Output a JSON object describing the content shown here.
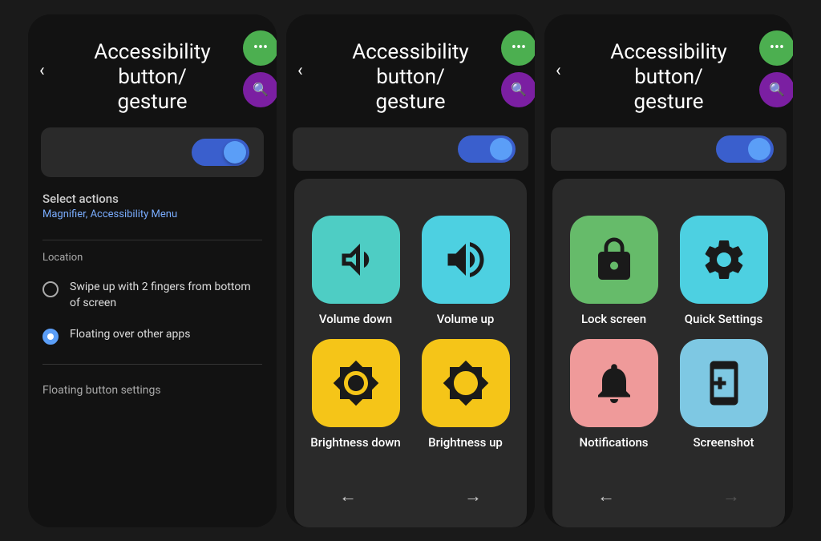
{
  "screens": [
    {
      "id": "screen1",
      "title": "Accessibility button/\ngesture",
      "back": "‹",
      "fab": {
        "green": "···",
        "purple": "🔍"
      },
      "toggle_on": true,
      "select_actions": {
        "label": "Select actions",
        "sub": "Magnifier, Accessibility Menu"
      },
      "location": {
        "label": "Location",
        "options": [
          {
            "id": "opt1",
            "text": "Swipe up with 2 fingers from bottom of screen",
            "selected": false
          },
          {
            "id": "opt2",
            "text": "Floating over other apps",
            "selected": true
          }
        ]
      },
      "floating_btn_settings": "Floating button settings"
    },
    {
      "id": "screen2",
      "title": "Accessibility button/\ngesture",
      "back": "‹",
      "fab": {
        "green": "···",
        "purple": "🔍"
      },
      "actions": [
        {
          "id": "volume-down",
          "label": "Volume down",
          "icon": "volume_down",
          "bg": "teal"
        },
        {
          "id": "volume-up",
          "label": "Volume up",
          "icon": "volume_up",
          "bg": "teal2"
        },
        {
          "id": "brightness-down",
          "label": "Brightness down",
          "icon": "brightness_low",
          "bg": "yellow"
        },
        {
          "id": "brightness-up",
          "label": "Brightness up",
          "icon": "brightness_high",
          "bg": "yellow"
        }
      ],
      "nav": {
        "left": "←",
        "right": "→"
      }
    },
    {
      "id": "screen3",
      "title": "Accessibility button/\ngesture",
      "back": "‹",
      "fab": {
        "green": "···",
        "purple": "🔍"
      },
      "actions": [
        {
          "id": "lock-screen",
          "label": "Lock screen",
          "icon": "lock",
          "bg": "green"
        },
        {
          "id": "quick-settings",
          "label": "Quick Settings",
          "icon": "settings",
          "bg": "teal2"
        },
        {
          "id": "notifications",
          "label": "Notifications",
          "icon": "bell",
          "bg": "pink"
        },
        {
          "id": "screenshot",
          "label": "Screenshot",
          "icon": "screenshot",
          "bg": "blue"
        }
      ],
      "nav": {
        "left": "←",
        "right": "→",
        "right_disabled": true
      }
    }
  ]
}
